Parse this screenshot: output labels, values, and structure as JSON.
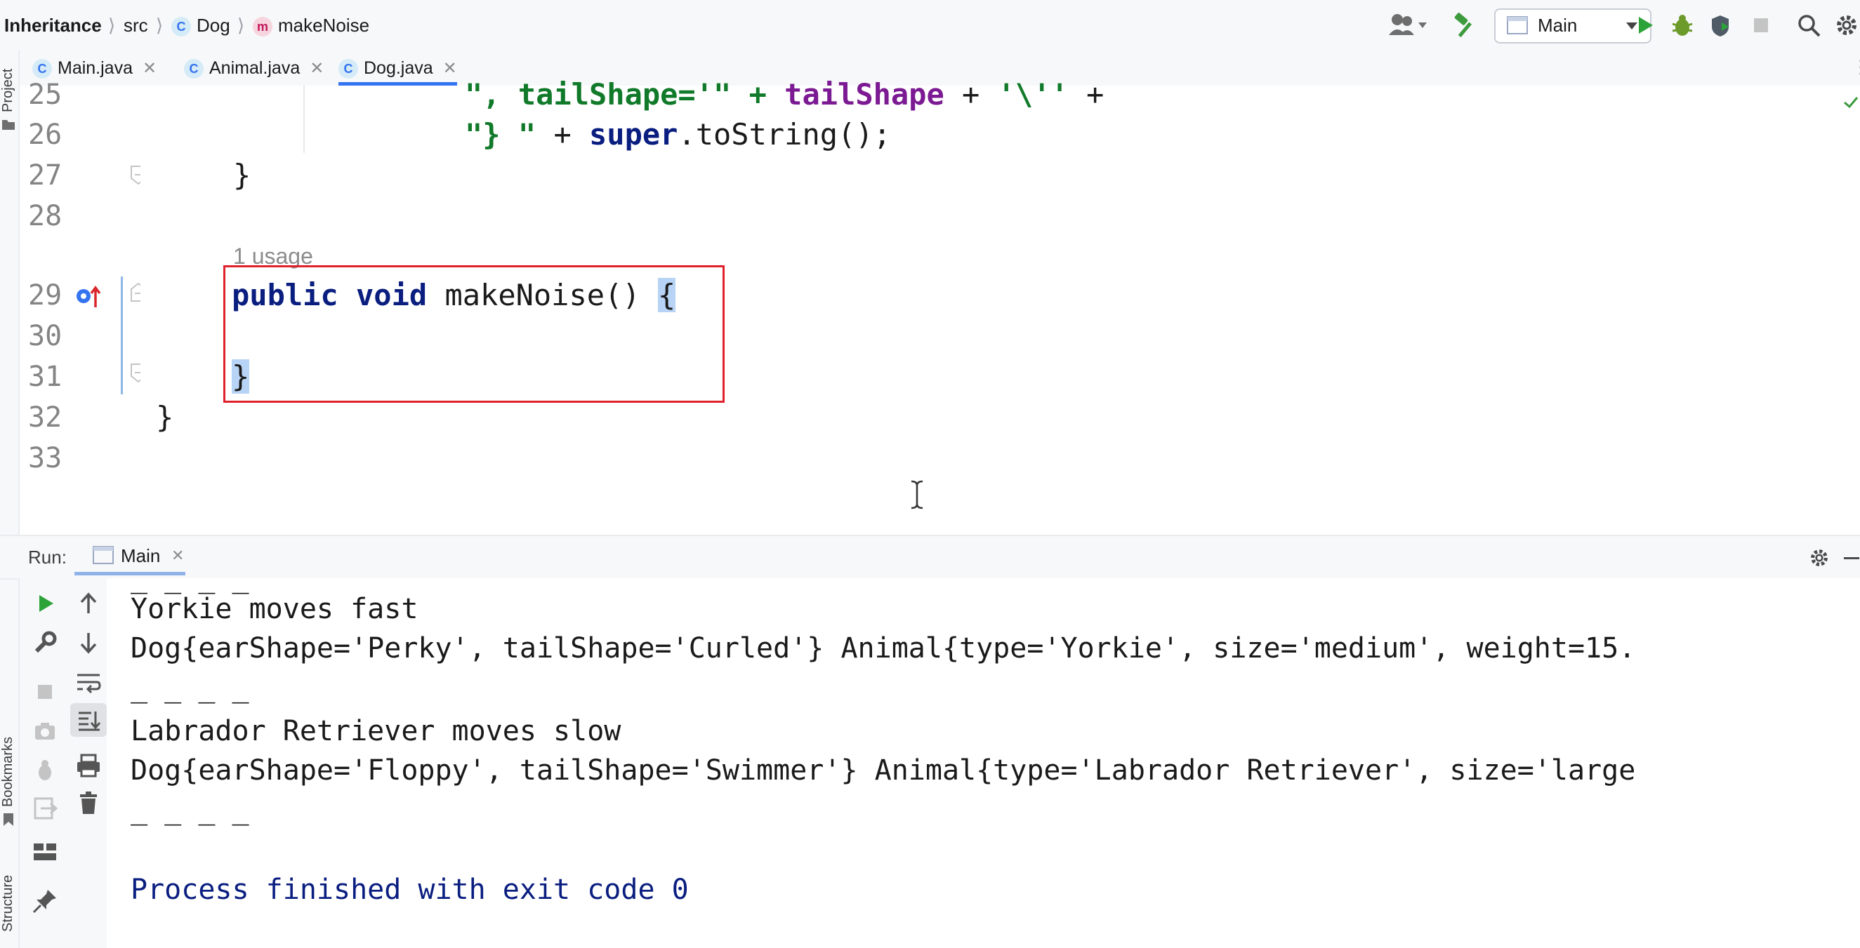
{
  "breadcrumb": {
    "project": "Inheritance",
    "folder": "src",
    "class_badge": "C",
    "class": "Dog",
    "method_badge": "m",
    "method": "makeNoise"
  },
  "toolbar": {
    "run_config": "Main",
    "icons": [
      "user-icon",
      "hammer-icon",
      "run-icon",
      "debug-icon",
      "coverage-icon",
      "stop-icon",
      "search-icon",
      "settings-icon"
    ]
  },
  "tabs": [
    {
      "badge": "C",
      "label": "Main.java",
      "active": false
    },
    {
      "badge": "C",
      "label": "Animal.java",
      "active": false
    },
    {
      "badge": "C",
      "label": "Dog.java",
      "active": true
    }
  ],
  "side_labels": {
    "project": "Project",
    "bookmarks": "Bookmarks",
    "structure": "Structure"
  },
  "editor": {
    "line_numbers": [
      "25",
      "26",
      "27",
      "28",
      "29",
      "30",
      "31",
      "32",
      "33"
    ],
    "line25": {
      "a": "\", ",
      "b": "tailShape=",
      "c": "'\" + ",
      "d": "tailShape",
      "e": " + ",
      "f": "'\\''",
      "g": " +"
    },
    "line26": {
      "a": "\"} \"",
      "b": " + ",
      "c": "super",
      "d": ".toString();"
    },
    "line27": "}",
    "usage_hint": "1 usage",
    "line29": {
      "kw1": "public",
      "kw2": "void",
      "name": "makeNoise() ",
      "brace": "{"
    },
    "line31": "}",
    "line32": "}"
  },
  "run_panel": {
    "label": "Run:",
    "tab": "Main",
    "output": [
      "_ _ _ _",
      "Yorkie moves fast",
      "Dog{earShape='Perky', tailShape='Curled'} Animal{type='Yorkie', size='medium', weight=15.",
      "_ _ _ _",
      "Labrador Retriever moves slow",
      "Dog{earShape='Floppy', tailShape='Swimmer'} Animal{type='Labrador Retriever', size='large",
      "_ _ _ _",
      "",
      "Process finished with exit code 0"
    ],
    "exit_color": "#0a1e80"
  }
}
